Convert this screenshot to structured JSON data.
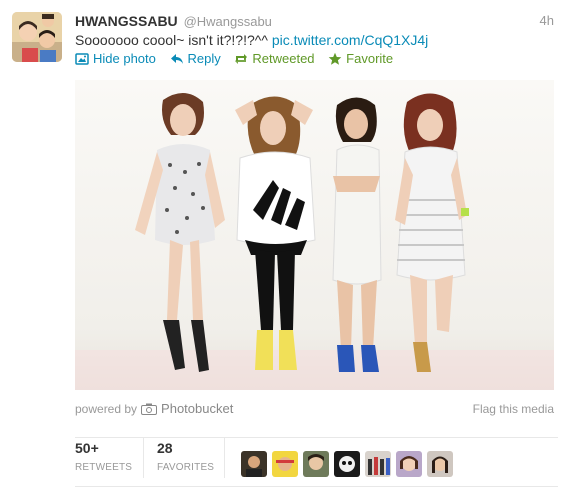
{
  "header": {
    "fullname": "HWANGSSABU",
    "username": "@Hwangssabu",
    "timestamp": "4h"
  },
  "tweet": {
    "text": "Sooooooo coool~ isn't it?!?!?^^",
    "link": "pic.twitter.com/CqQ1XJ4j"
  },
  "actions": {
    "hide_photo": "Hide photo",
    "reply": "Reply",
    "retweeted": "Retweeted",
    "favorite": "Favorite"
  },
  "media_footer": {
    "powered_by": "powered by",
    "provider": "Photobucket",
    "flag": "Flag this media"
  },
  "stats": {
    "retweets_count": "50+",
    "retweets_label": "RETWEETS",
    "favorites_count": "28",
    "favorites_label": "FAVORITES"
  },
  "colors": {
    "link": "#0a8bb7",
    "retweeted": "#609928",
    "muted": "#999999"
  },
  "icons": [
    "photo-icon",
    "reply-icon",
    "retweet-icon",
    "star-icon",
    "camera-icon"
  ],
  "faces": [
    {
      "name": "face-1"
    },
    {
      "name": "face-2"
    },
    {
      "name": "face-3"
    },
    {
      "name": "face-4"
    },
    {
      "name": "face-5"
    },
    {
      "name": "face-6"
    },
    {
      "name": "face-7"
    }
  ]
}
